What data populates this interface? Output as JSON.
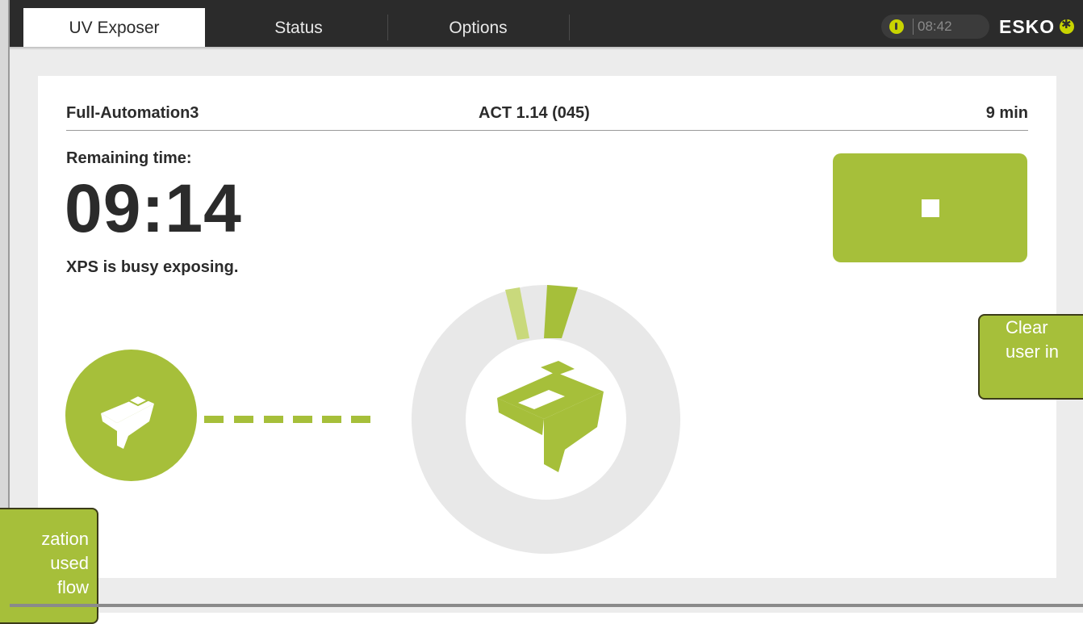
{
  "tabs": [
    {
      "label": "UV Exposer",
      "active": true
    },
    {
      "label": "Status",
      "active": false
    },
    {
      "label": "Options",
      "active": false
    }
  ],
  "header": {
    "clock": "08:42",
    "logo": "ESKO",
    "temperature_icon": "thermometer-icon"
  },
  "job": {
    "name": "Full-Automation3",
    "act": "ACT 1.14 (045)",
    "duration": "9 min"
  },
  "timer": {
    "label": "Remaining time:",
    "value": "09:14"
  },
  "status_message": "XPS is busy exposing.",
  "stop_button": {
    "icon": "stop-icon"
  },
  "progress": {
    "segments_done_fraction": 0.03
  },
  "callouts": {
    "right_lines": [
      "Clear",
      "user in"
    ],
    "left_lines": [
      "zation",
      "used",
      "flow"
    ]
  },
  "colors": {
    "accent": "#a6bf3a",
    "accent_light": "#c8d400",
    "topbar": "#2b2b2b",
    "ring": "#e8e8e8"
  }
}
